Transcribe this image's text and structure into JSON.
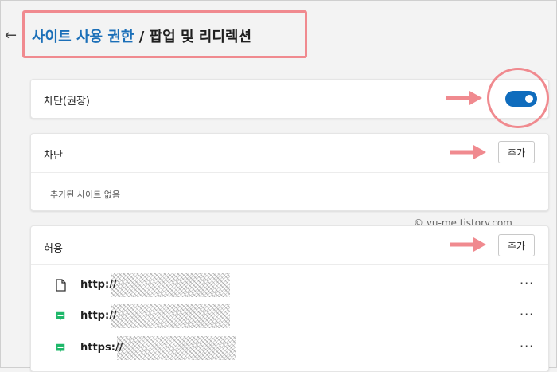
{
  "header": {
    "back_icon": "arrow-left-icon",
    "breadcrumb_link": "사이트 사용 권한",
    "separator": " / ",
    "current_page": "팝업 및 리디렉션"
  },
  "block_setting": {
    "label": "차단(권장)",
    "toggle_on": true,
    "accent_color": "#0f6cbd"
  },
  "deny_section": {
    "title": "차단",
    "add_label": "추가",
    "empty_text": "추가된 사이트 없음"
  },
  "allow_section": {
    "title": "허용",
    "add_label": "추가",
    "sites": [
      {
        "icon": "file-icon",
        "url": "http://",
        "more": "···"
      },
      {
        "icon": "blog-icon",
        "url": "http://",
        "more": "···"
      },
      {
        "icon": "blog-icon",
        "url": "https://",
        "more": "···"
      }
    ]
  },
  "watermark": "© yu-me.tistory.com",
  "annotation_color": "#f08a8f"
}
